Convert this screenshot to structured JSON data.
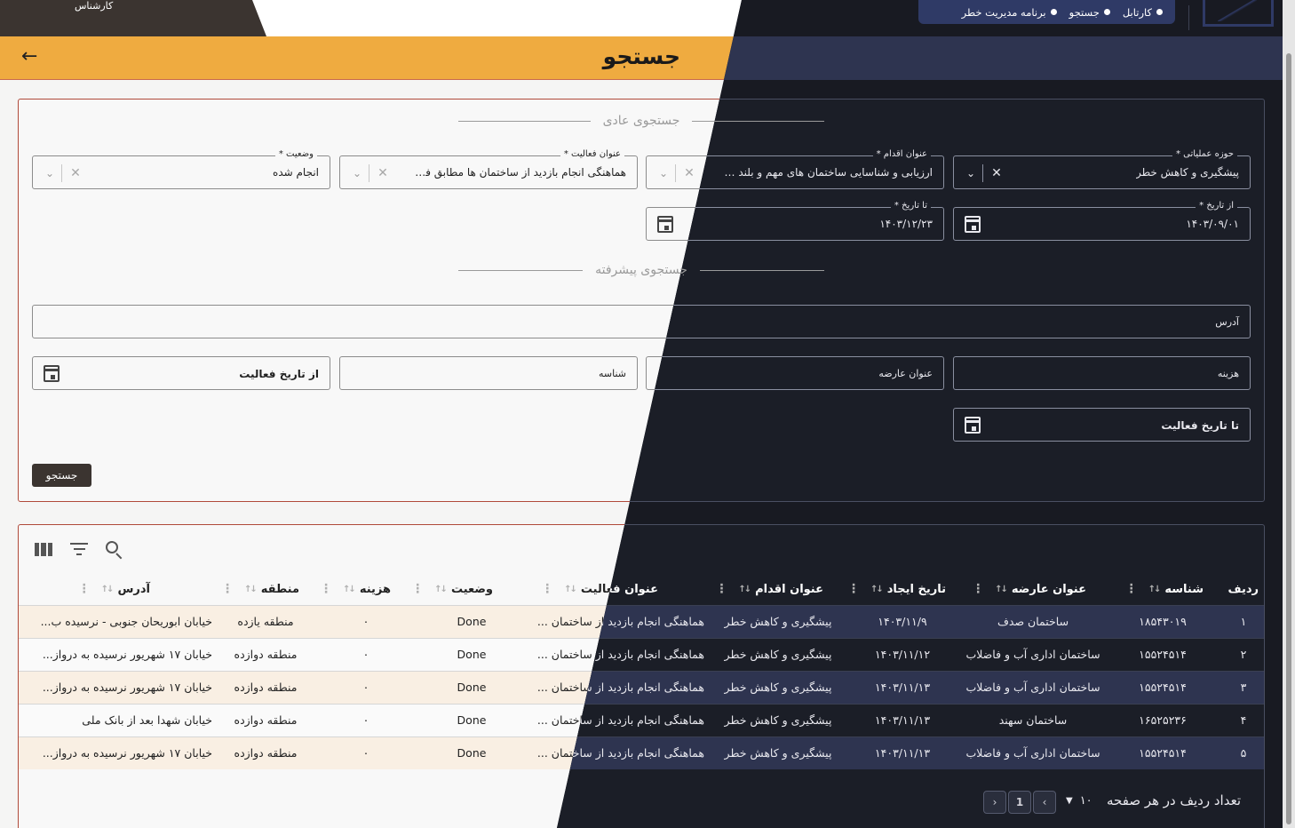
{
  "topbar": {
    "user_label": "کارشناس",
    "breadcrumbs": [
      "کارتابل",
      "جستجو",
      "برنامه مدیریت خطر"
    ]
  },
  "page": {
    "title": "جستجو",
    "back_icon": "arrow-left-icon"
  },
  "basic_search": {
    "title": "جستجوی عادی",
    "operational_area": {
      "label": "* حوزه عملیاتی",
      "value": "پیشگیری و کاهش خطر"
    },
    "action_title": {
      "label": "* عنوان اقدام",
      "value": "ارزیابی و شناسایی ساختمان های مهم و بلند مرت..."
    },
    "activity_title": {
      "label": "* عنوان فعالیت",
      "value": "هماهنگی انجام بازدید از ساختمان ها مطابق فهر..."
    },
    "status": {
      "label": "* وضعیت",
      "value": "انجام شده"
    },
    "from_date": {
      "label": "* از تاریخ",
      "value": "۱۴۰۳/۰۹/۰۱"
    },
    "to_date": {
      "label": "* تا تاریخ",
      "value": "۱۴۰۳/۱۲/۲۳"
    }
  },
  "advanced_search": {
    "title": "جستجوی پیشرفته",
    "address_placeholder": "آدرس",
    "cost_placeholder": "هزینه",
    "subject_title_placeholder": "عنوان عارضه",
    "id_placeholder": "شناسه",
    "from_activity_date_placeholder": "از تاریخ فعالیت",
    "to_activity_date_placeholder": "تا تاریخ فعالیت"
  },
  "search_button": "جستجو",
  "table": {
    "headers": [
      "ردیف",
      "شناسه",
      "عنوان عارضه",
      "تاریخ ایجاد",
      "عنوان اقدام",
      "عنوان فعالیت",
      "وضعیت",
      "هزینه",
      "منطقه",
      "آدرس"
    ],
    "rows": [
      [
        "۱",
        "۱۸۵۴۳۰۱۹",
        "ساختمان صدف",
        "۱۴۰۳/۱۱/۹",
        "پیشگیری و کاهش خطر",
        "هماهنگی انجام بازدید از ساختمان ...",
        "Done",
        "۰",
        "منطقه یازده",
        "خیابان ابوریحان جنوبی - نرسیده ب..."
      ],
      [
        "۲",
        "۱۵۵۲۴۵۱۴",
        "ساختمان اداری آب و فاضلاب",
        "۱۴۰۳/۱۱/۱۲",
        "پیشگیری و کاهش خطر",
        "هماهنگی انجام بازدید از ساختمان ...",
        "Done",
        "۰",
        "منطقه دوازده",
        "خیابان ۱۷ شهریور نرسیده به درواز..."
      ],
      [
        "۳",
        "۱۵۵۲۴۵۱۴",
        "ساختمان اداری آب و فاضلاب",
        "۱۴۰۳/۱۱/۱۳",
        "پیشگیری و کاهش خطر",
        "هماهنگی انجام بازدید از ساختمان ...",
        "Done",
        "۰",
        "منطقه دوازده",
        "خیابان ۱۷ شهریور نرسیده به درواز..."
      ],
      [
        "۴",
        "۱۶۵۲۵۲۳۶",
        "ساختمان سهند",
        "۱۴۰۳/۱۱/۱۳",
        "پیشگیری و کاهش خطر",
        "هماهنگی انجام بازدید از ساختمان ...",
        "Done",
        "۰",
        "منطقه دوازده",
        "خیابان شهدا بعد از بانک ملی"
      ],
      [
        "۵",
        "۱۵۵۲۴۵۱۴",
        "ساختمان اداری آب و فاضلاب",
        "۱۴۰۳/۱۱/۱۳",
        "پیشگیری و کاهش خطر",
        "هماهنگی انجام بازدید از ساختمان ...",
        "Done",
        "۰",
        "منطقه دوازده",
        "خیابان ۱۷ شهریور نرسیده به درواز..."
      ]
    ]
  },
  "pagination": {
    "rows_per_page_label": "تعداد ردیف در هر صفحه",
    "rows_per_page_value": "۱۰",
    "current_page": "1"
  },
  "colors": {
    "header_accent": "#efab40",
    "dark_bg": "#181a22",
    "dark_accent": "#2e3450",
    "button_bg": "#3b3430"
  }
}
